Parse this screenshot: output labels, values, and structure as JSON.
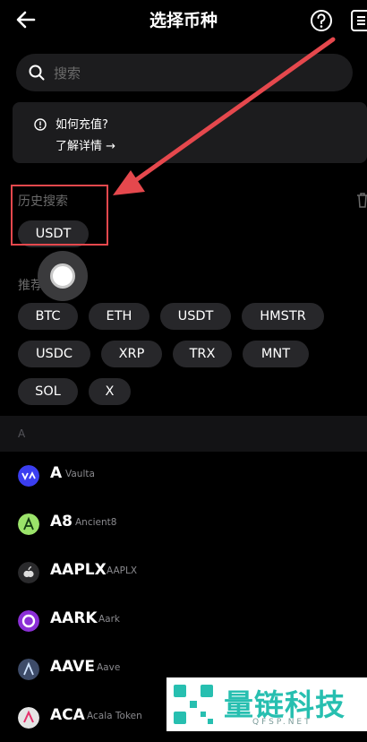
{
  "header": {
    "title": "选择币种",
    "back_icon": "arrow-left-icon",
    "help_icon": "question-circle-icon",
    "menu_icon": "list-icon"
  },
  "search": {
    "placeholder": "搜索",
    "value": ""
  },
  "info": {
    "title": "如何充值?",
    "link": "了解详情 →"
  },
  "history": {
    "title": "历史搜索",
    "chips": [
      "USDT"
    ]
  },
  "recommend": {
    "title": "推荐",
    "chips": [
      "BTC",
      "ETH",
      "USDT",
      "HMSTR",
      "USDC",
      "XRP",
      "TRX",
      "MNT",
      "SOL",
      "X"
    ]
  },
  "section": {
    "letter": "A"
  },
  "coins": [
    {
      "symbol": "A",
      "name": "Vaulta",
      "color": "#3b3ef0"
    },
    {
      "symbol": "A8",
      "name": "Ancient8",
      "color": "#9be36a"
    },
    {
      "symbol": "AAPLX",
      "name": "AAPLX",
      "color": "#2a2a2c"
    },
    {
      "symbol": "AARK",
      "name": "Aark",
      "color": "#8b2fd6"
    },
    {
      "symbol": "AAVE",
      "name": "Aave",
      "color": "#3d4b68"
    },
    {
      "symbol": "ACA",
      "name": "Acala Token",
      "color": "#e4e4e4"
    }
  ],
  "watermark": {
    "brand": "量链科技",
    "domain": "QFSP.NET"
  },
  "colors": {
    "accent_red": "#e5484d",
    "chip_bg": "#27272a",
    "panel_bg": "#1c1c1e"
  }
}
